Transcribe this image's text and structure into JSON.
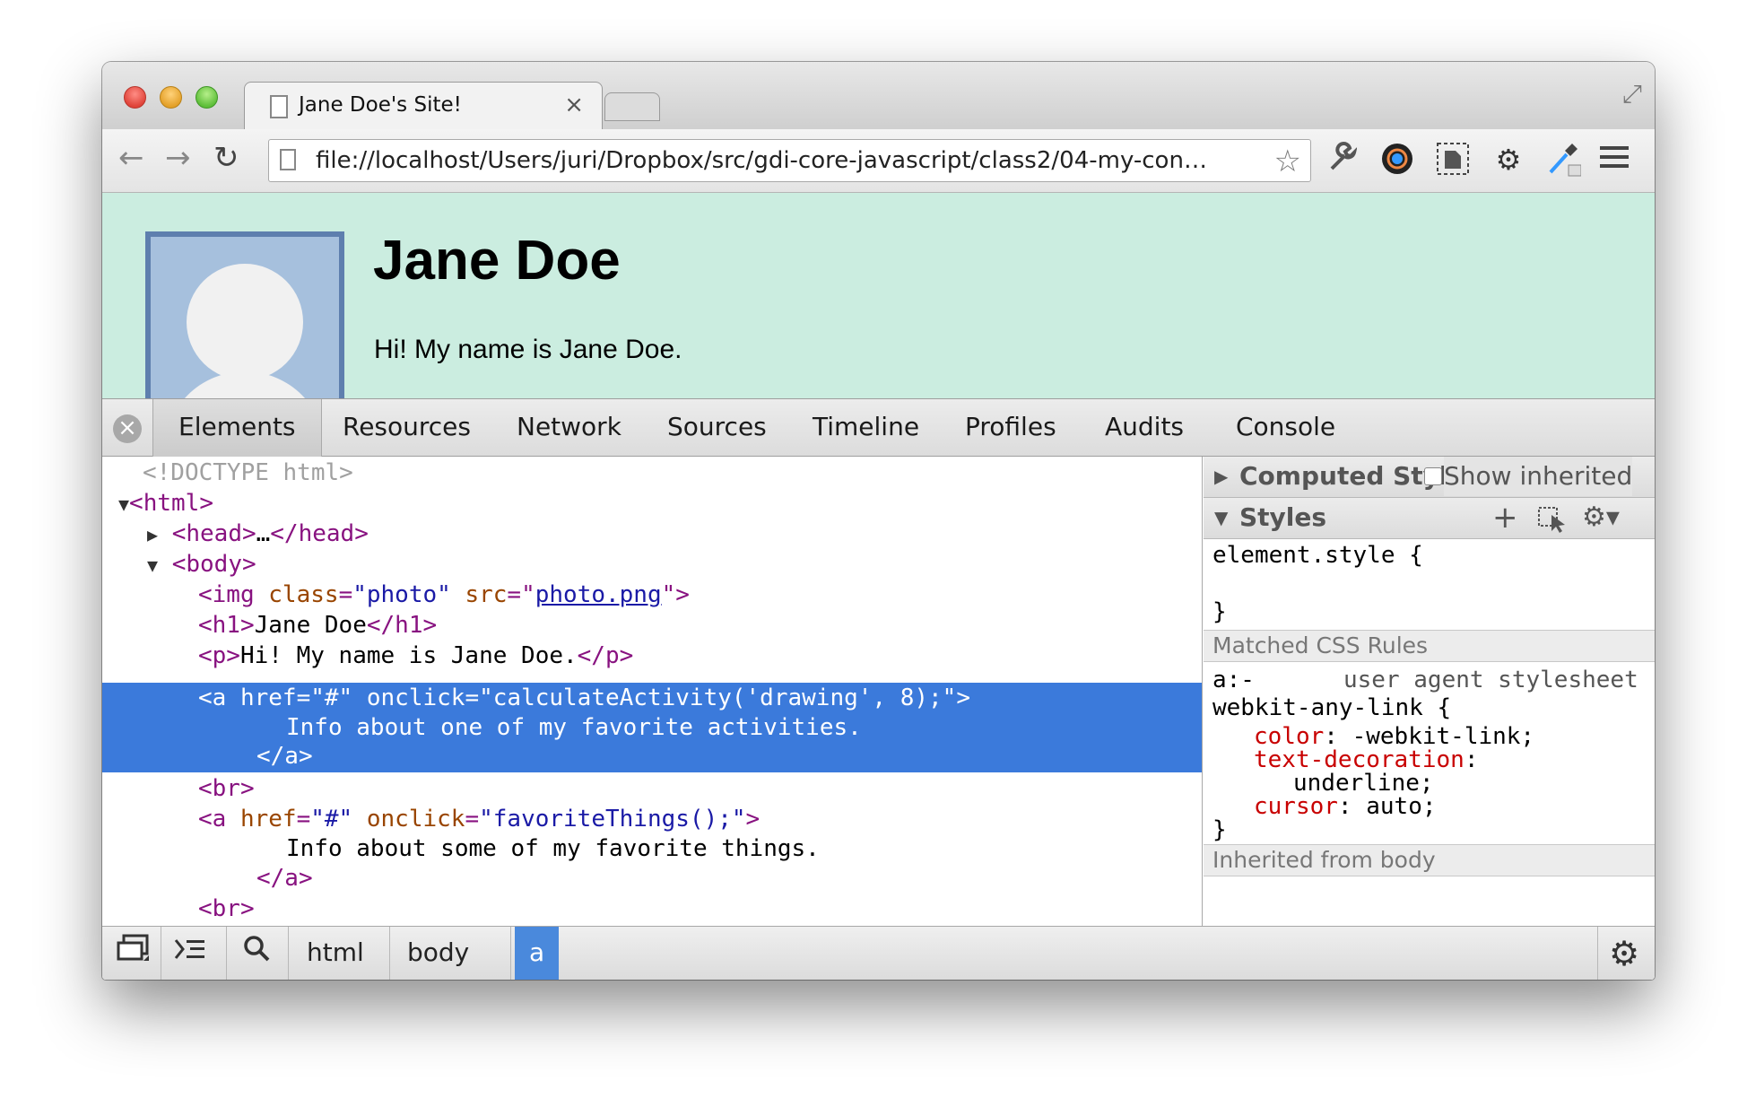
{
  "browser": {
    "tab_title": "Jane Doe's Site!",
    "tab_close": "×",
    "url": "file://localhost/Users/juri/Dropbox/src/gdi-core-javascript/class2/04-my-con…",
    "back_glyph": "←",
    "forward_glyph": "→",
    "reload_glyph": "↻",
    "star_glyph": "☆",
    "fullscreen_glyph": "⤢",
    "toolbar_icons": [
      "wrench-icon",
      "camera-icon",
      "evernote-icon",
      "gear-icon",
      "eyedropper-icon",
      "menu-icon"
    ]
  },
  "page": {
    "heading": "Jane Doe",
    "paragraph": "Hi! My name is Jane Doe."
  },
  "devtools": {
    "close_glyph": "×",
    "tabs": [
      "Elements",
      "Resources",
      "Network",
      "Sources",
      "Timeline",
      "Profiles",
      "Audits",
      "Console"
    ],
    "active_tab": "Elements",
    "dom": {
      "doctype": "<!DOCTYPE html>",
      "html_open": "<html>",
      "head_open": "<head>",
      "head_ellipsis": "…",
      "head_close": "</head>",
      "body_open": "<body>",
      "img_tag": "<img",
      "img_class_attr": "class",
      "img_class_val": "\"photo\"",
      "img_src_attr": "src",
      "img_src_val": "photo.png",
      "h1_open": "<h1>",
      "h1_text": "Jane Doe",
      "h1_close": "</h1>",
      "p_open": "<p>",
      "p_text": "Hi! My name is Jane Doe.",
      "p_close": "</p>",
      "a1_open": "<a",
      "a1_href_attr": "href",
      "a1_href_val": "\"#\"",
      "a1_onclick_attr": "onclick",
      "a1_onclick_val": "\"calculateActivity('drawing', 8);\"",
      "a1_text": "Info about one of my favorite activities.",
      "a_close": "</a>",
      "br": "<br>",
      "a2_open": "<a",
      "a2_href_attr": "href",
      "a2_href_val": "\"#\"",
      "a2_onclick_attr": "onclick",
      "a2_onclick_val": "\"favoriteThings();\"",
      "a2_text": "Info about some of my favorite things."
    },
    "sidebar": {
      "computed_style": "Computed Style",
      "show_inherited": "Show inherited",
      "styles": "Styles",
      "add_glyph": "+",
      "element_style_open": "element.style {",
      "close_brace": "}",
      "matched_rules": "Matched CSS Rules",
      "rule_selector_1": "a:-",
      "rule_source": "user agent stylesheet",
      "rule_selector_2": "webkit-any-link {",
      "props": [
        {
          "name": "color",
          "value": " -webkit-link;"
        },
        {
          "name": "text-decoration",
          "value": ""
        },
        {
          "name": "",
          "value": "underline;"
        },
        {
          "name": "cursor",
          "value": " auto;"
        }
      ],
      "inherited_from": "Inherited from body"
    },
    "breadcrumbs": [
      "html",
      "body",
      "a"
    ],
    "active_crumb": "a"
  },
  "colors": {
    "page_background": "#cbede0",
    "selection": "#3b7adb",
    "tag": "#881280",
    "attr_name": "#994500",
    "attr_value": "#1a1aa6",
    "css_property": "#c80000"
  }
}
